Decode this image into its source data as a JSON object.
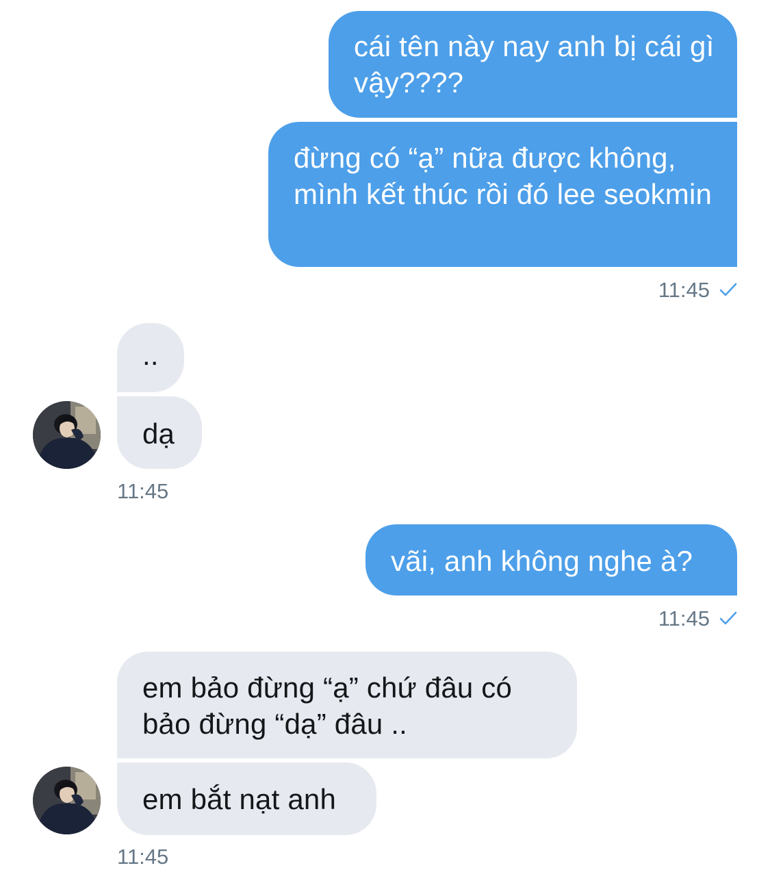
{
  "conversation": {
    "messages": [
      {
        "sender": "me",
        "text": "cái tên này nay anh bị cái gì vậy????"
      },
      {
        "sender": "me",
        "text": "đừng có “ạ” nữa được không, mình kết thúc rồi đó lee seokmin"
      },
      {
        "sender": "me_time",
        "text": "11:45"
      },
      {
        "sender": "them",
        "text": ".."
      },
      {
        "sender": "them",
        "text": "dạ"
      },
      {
        "sender": "them_time",
        "text": "11:45"
      },
      {
        "sender": "me",
        "text": "vãi, anh không nghe à?"
      },
      {
        "sender": "me_time",
        "text": "11:45"
      },
      {
        "sender": "them",
        "text": "em bảo đừng “ạ” chứ đâu có bảo đừng “dạ” đâu .."
      },
      {
        "sender": "them",
        "text": "em bắt nạt anh"
      },
      {
        "sender": "them_time",
        "text": "11:45"
      }
    ]
  },
  "colors": {
    "outgoing_bubble": "#4d9fe9",
    "incoming_bubble": "#e6e9ef",
    "timestamp": "#657786",
    "read_check": "#4d9fe9"
  },
  "icons": {
    "read_receipt": "checkmark-icon",
    "avatar": "user-avatar-photo"
  }
}
